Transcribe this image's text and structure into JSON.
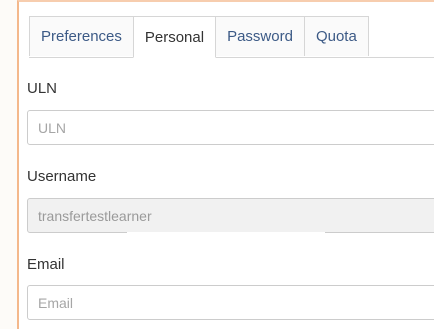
{
  "tabs": [
    {
      "label": "Preferences"
    },
    {
      "label": "Personal"
    },
    {
      "label": "Password"
    },
    {
      "label": "Quota"
    }
  ],
  "form": {
    "uln_label": "ULN",
    "uln_placeholder": "ULN",
    "uln_value": "",
    "username_label": "Username",
    "username_value": "transfertestlearner",
    "email_label": "Email",
    "email_placeholder": "Email",
    "email_value": ""
  },
  "colors": {
    "accent_border": "#f4b88c",
    "tab_text": "#3c5a86"
  }
}
